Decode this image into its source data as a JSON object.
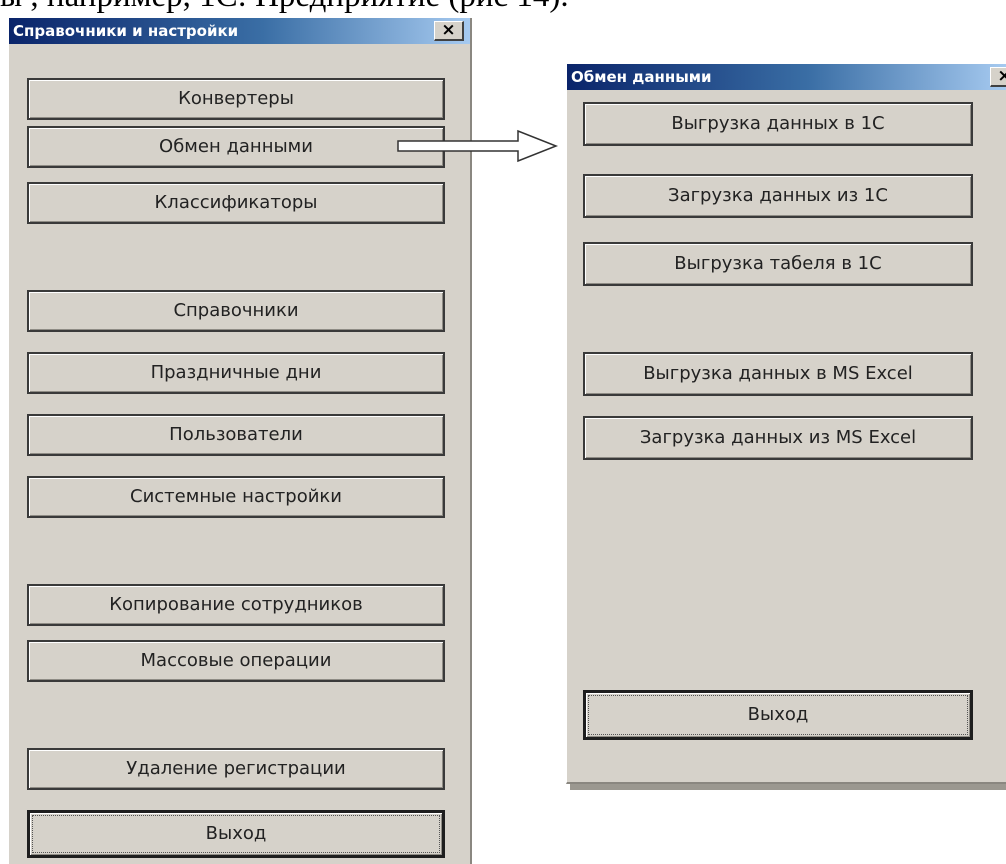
{
  "page_text": "ы , например, 1С: Предприятие (рис 14).",
  "main_window": {
    "title": "Справочники и настройки",
    "close_symbol": "×",
    "buttons": [
      "Конвертеры",
      "Обмен данными",
      "Классификаторы",
      "Справочники",
      "Праздничные дни",
      "Пользователи",
      "Системные настройки",
      "Копирование сотрудников",
      "Массовые операции",
      "Удаление регистрации",
      "Выход"
    ]
  },
  "exchange_window": {
    "title": "Обмен данными",
    "close_symbol": "×",
    "buttons": [
      "Выгрузка данных в 1С",
      "Загрузка данных из 1С",
      "Выгрузка  табеля в 1С",
      "Выгрузка данных в MS Excel",
      "Загрузка данных из MS Excel",
      "Выход"
    ]
  },
  "colors": {
    "window_face": "#d6d2ca",
    "titlebar_start": "#0a246a",
    "titlebar_end": "#a6caf0",
    "button_border": "#3a3a3a"
  },
  "icons": {
    "close": "close-icon",
    "arrow": "arrow-right-icon"
  }
}
